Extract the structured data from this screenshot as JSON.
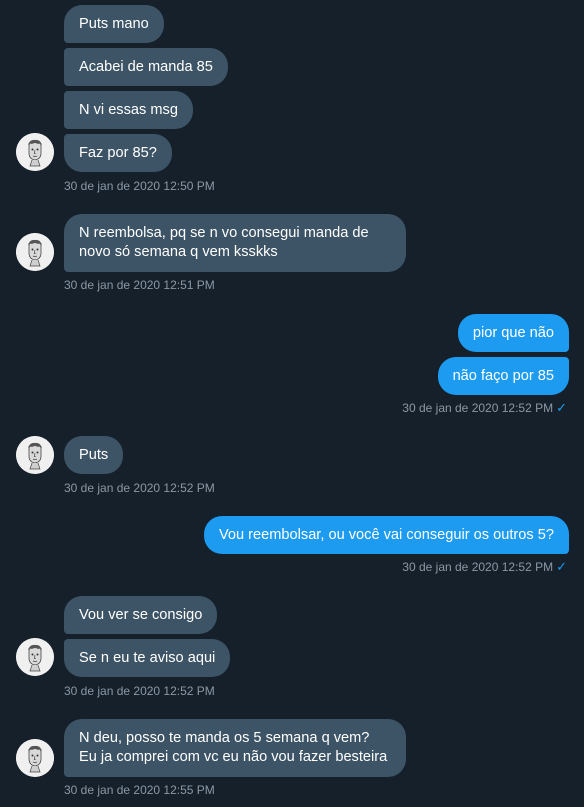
{
  "conversation": {
    "g1": {
      "msgs": [
        "Puts mano",
        "Acabei de manda 85",
        "N vi essas msg",
        "Faz por 85?"
      ],
      "time": "30 de jan de 2020 12:50 PM"
    },
    "g2": {
      "msg": "N reembolsa, pq se n vo consegui manda de novo só semana q vem ksskks",
      "time": "30 de jan de 2020 12:51 PM"
    },
    "g3": {
      "msgs": [
        "pior que não",
        "não faço por 85"
      ],
      "time": "30 de jan de 2020 12:52 PM"
    },
    "g4": {
      "msg": "Puts",
      "time": "30 de jan de 2020 12:52 PM"
    },
    "g5": {
      "msg": "Vou reembolsar, ou você vai conseguir os outros 5?",
      "time": "30 de jan de 2020 12:52 PM"
    },
    "g6": {
      "msgs": [
        "Vou ver se consigo",
        "Se n eu te aviso aqui"
      ],
      "time": "30 de jan de 2020 12:52 PM"
    },
    "g7": {
      "msg": "N deu, posso te manda os 5 semana q vem? Eu ja comprei com vc eu não vou fazer besteira",
      "time": "30 de jan de 2020 12:55 PM"
    }
  },
  "icons": {
    "sent_check": "✓",
    "avatar": "statue-bust-avatar"
  },
  "colors": {
    "background": "#15202b",
    "incoming_bubble": "#3d5466",
    "outgoing_bubble": "#1d9bf0",
    "timestamp": "#8b98a5"
  }
}
